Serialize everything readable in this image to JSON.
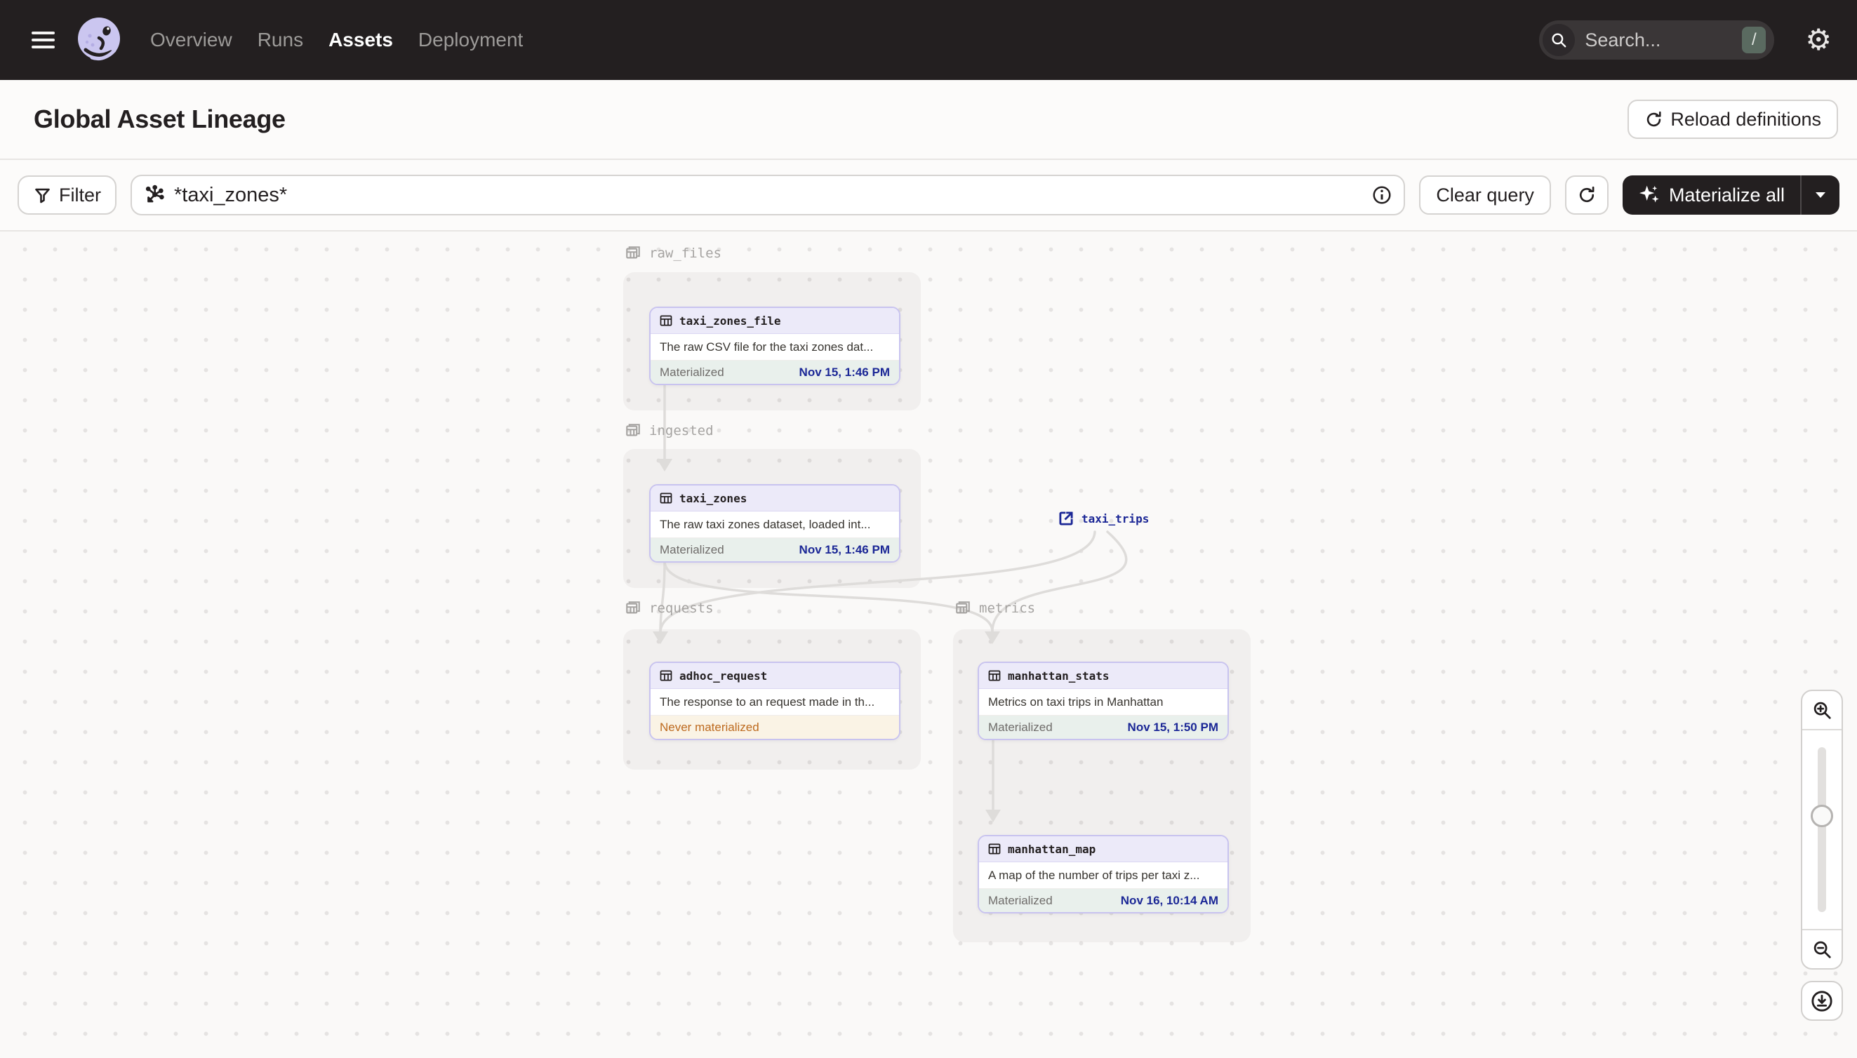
{
  "topbar": {
    "nav_items": [
      {
        "label": "Overview",
        "active": false
      },
      {
        "label": "Runs",
        "active": false
      },
      {
        "label": "Assets",
        "active": true
      },
      {
        "label": "Deployment",
        "active": false
      }
    ],
    "search": {
      "placeholder": "Search...",
      "shortcut": "/"
    }
  },
  "header": {
    "title": "Global Asset Lineage",
    "reload_label": "Reload definitions"
  },
  "toolbar": {
    "filter_label": "Filter",
    "query_value": "*taxi_zones*",
    "clear_label": "Clear query",
    "materialize_label": "Materialize all"
  },
  "graph": {
    "groups": [
      {
        "name": "raw_files"
      },
      {
        "name": "ingested"
      },
      {
        "name": "requests"
      },
      {
        "name": "metrics"
      }
    ],
    "nodes": [
      {
        "name": "taxi_zones_file",
        "group": "raw_files",
        "description": "The raw CSV file for the taxi zones dat...",
        "status": "Materialized",
        "timestamp": "Nov 15, 1:46 PM"
      },
      {
        "name": "taxi_zones",
        "group": "ingested",
        "description": "The raw taxi zones dataset, loaded int...",
        "status": "Materialized",
        "timestamp": "Nov 15, 1:46 PM"
      },
      {
        "name": "adhoc_request",
        "group": "requests",
        "description": "The response to an request made in th...",
        "status": "Never materialized",
        "timestamp": ""
      },
      {
        "name": "manhattan_stats",
        "group": "metrics",
        "description": "Metrics on taxi trips in Manhattan",
        "status": "Materialized",
        "timestamp": "Nov 15, 1:50 PM"
      },
      {
        "name": "manhattan_map",
        "group": "metrics",
        "description": "A map of the number of trips per taxi z...",
        "status": "Materialized",
        "timestamp": "Nov 16, 10:14 AM"
      }
    ],
    "external_assets": [
      {
        "name": "taxi_trips"
      }
    ],
    "edges": [
      {
        "from": "taxi_zones_file",
        "to": "taxi_zones"
      },
      {
        "from": "taxi_zones",
        "to": "adhoc_request"
      },
      {
        "from": "taxi_zones",
        "to": "manhattan_stats"
      },
      {
        "from": "taxi_trips",
        "to": "adhoc_request"
      },
      {
        "from": "taxi_trips",
        "to": "manhattan_stats"
      },
      {
        "from": "manhattan_stats",
        "to": "manhattan_map"
      }
    ]
  },
  "colors": {
    "topbar_bg": "#231F20",
    "accent_lavender": "#ECEAF9",
    "node_border": "#C8C3EF",
    "materialized_bg": "#E9F0EC",
    "timestamp_navy": "#1B2796",
    "never_materialized_bg": "#FAF3E5",
    "never_materialized_text": "#BD6A1F",
    "edge": "#DEDCDA"
  }
}
